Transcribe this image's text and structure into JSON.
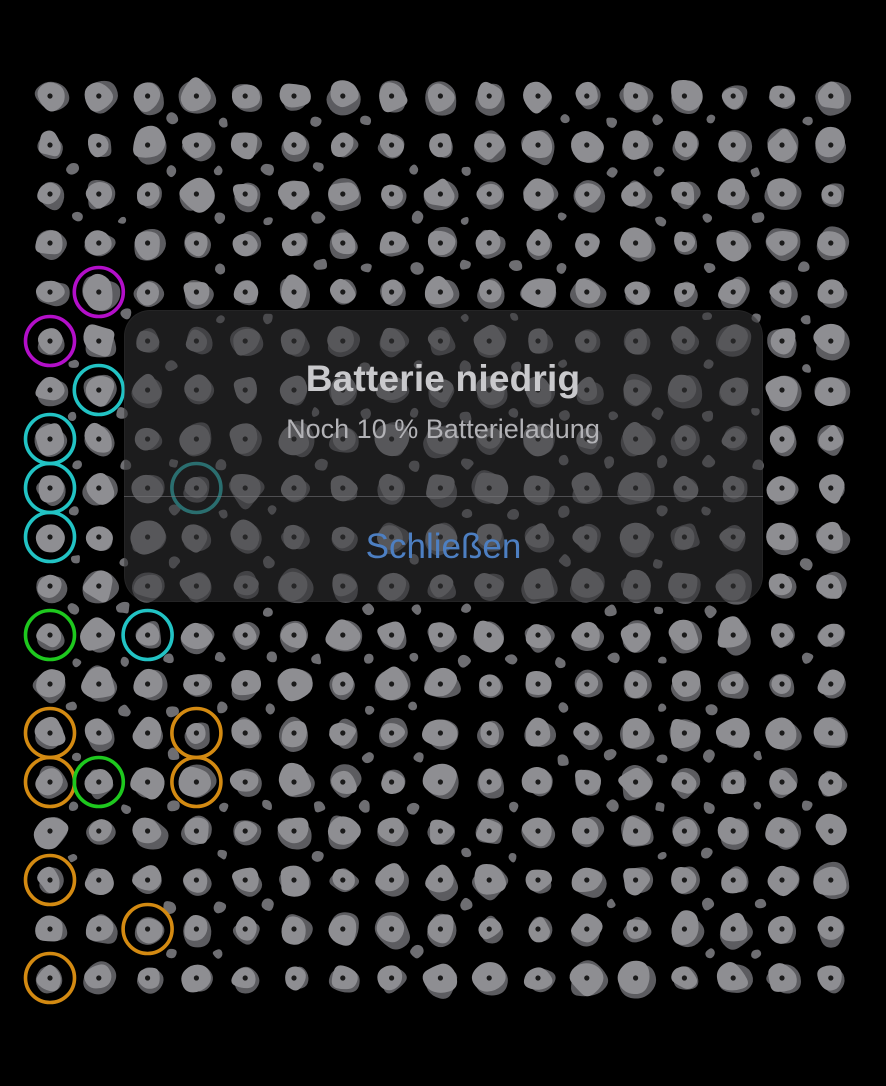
{
  "board": {
    "hold_color": "#8e8e92",
    "hold_edge_color": "#5c5c60",
    "bolt_color": "#1a1a1a",
    "rows": 19,
    "columns": 17,
    "markers": [
      {
        "row": 4,
        "col": 1,
        "role": "start",
        "color": "#b30fc9"
      },
      {
        "row": 5,
        "col": 0,
        "role": "start",
        "color": "#b30fc9"
      },
      {
        "row": 6,
        "col": 1,
        "role": "hand",
        "color": "#22c3c4"
      },
      {
        "row": 7,
        "col": 0,
        "role": "hand",
        "color": "#22c3c4"
      },
      {
        "row": 8,
        "col": 0,
        "role": "hand",
        "color": "#22c3c4"
      },
      {
        "row": 8,
        "col": 3,
        "role": "hand",
        "color": "#22c3c4"
      },
      {
        "row": 9,
        "col": 0,
        "role": "hand",
        "color": "#22c3c4"
      },
      {
        "row": 11,
        "col": 0,
        "role": "finish",
        "color": "#1ec81e"
      },
      {
        "row": 11,
        "col": 2,
        "role": "hand",
        "color": "#22c3c4"
      },
      {
        "row": 13,
        "col": 0,
        "role": "foot",
        "color": "#d38a12"
      },
      {
        "row": 13,
        "col": 3,
        "role": "foot",
        "color": "#d38a12"
      },
      {
        "row": 14,
        "col": 0,
        "role": "foot",
        "color": "#d38a12"
      },
      {
        "row": 14,
        "col": 1,
        "role": "finish",
        "color": "#1ec81e"
      },
      {
        "row": 14,
        "col": 3,
        "role": "foot",
        "color": "#d38a12"
      },
      {
        "row": 16,
        "col": 0,
        "role": "foot",
        "color": "#d38a12"
      },
      {
        "row": 17,
        "col": 2,
        "role": "foot",
        "color": "#d38a12"
      },
      {
        "row": 18,
        "col": 0,
        "role": "foot",
        "color": "#d38a12"
      }
    ]
  },
  "alert": {
    "title": "Batterie niedrig",
    "message": "Noch 10 % Batterieladung",
    "button_label": "Schließen",
    "button_color": "#4d7fc2"
  }
}
